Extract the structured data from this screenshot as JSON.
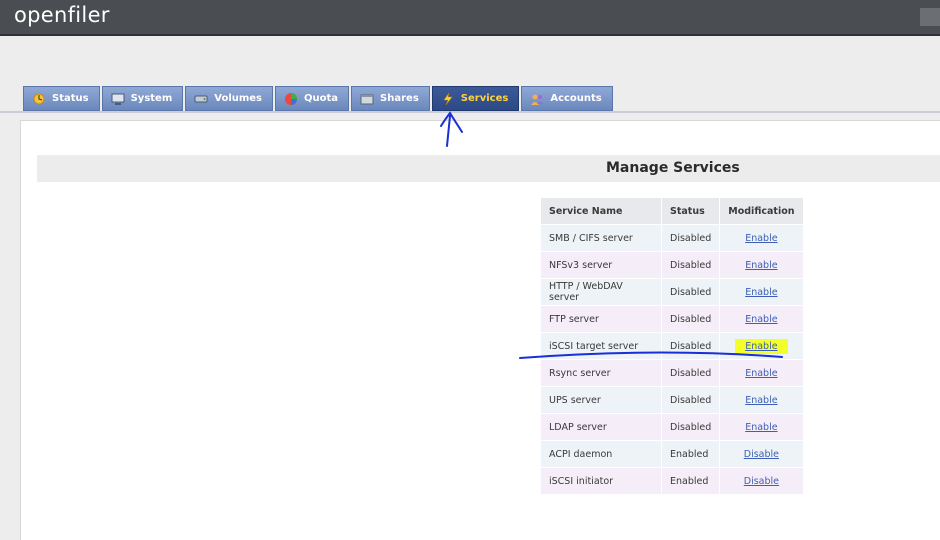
{
  "app": {
    "logo": "openfiler"
  },
  "tabs": [
    {
      "label": "Status",
      "icon": "status-icon",
      "active": false
    },
    {
      "label": "System",
      "icon": "system-icon",
      "active": false
    },
    {
      "label": "Volumes",
      "icon": "volumes-icon",
      "active": false
    },
    {
      "label": "Quota",
      "icon": "quota-icon",
      "active": false
    },
    {
      "label": "Shares",
      "icon": "shares-icon",
      "active": false
    },
    {
      "label": "Services",
      "icon": "services-icon",
      "active": true
    },
    {
      "label": "Accounts",
      "icon": "accounts-icon",
      "active": false
    }
  ],
  "page": {
    "title": "Manage Services"
  },
  "table": {
    "headers": [
      "Service Name",
      "Status",
      "Modification"
    ],
    "rows": [
      {
        "name": "SMB / CIFS server",
        "status": "Disabled",
        "action": "Enable"
      },
      {
        "name": "NFSv3 server",
        "status": "Disabled",
        "action": "Enable"
      },
      {
        "name": "HTTP / WebDAV server",
        "status": "Disabled",
        "action": "Enable"
      },
      {
        "name": "FTP server",
        "status": "Disabled",
        "action": "Enable"
      },
      {
        "name": "iSCSI target server",
        "status": "Disabled",
        "action": "Enable",
        "highlighted": true
      },
      {
        "name": "Rsync server",
        "status": "Disabled",
        "action": "Enable"
      },
      {
        "name": "UPS server",
        "status": "Disabled",
        "action": "Enable"
      },
      {
        "name": "LDAP server",
        "status": "Disabled",
        "action": "Enable"
      },
      {
        "name": "ACPI daemon",
        "status": "Enabled",
        "action": "Disable"
      },
      {
        "name": "iSCSI initiator",
        "status": "Enabled",
        "action": "Disable"
      }
    ]
  },
  "colors": {
    "topbar": "#4a4d52",
    "tab": "#7f9acb",
    "tab_active": "#2d4a86",
    "tab_active_text": "#ffd43b",
    "link": "#3d5fb4",
    "highlight": "#f3ff2a",
    "annotation_ink": "#1a2fd6"
  }
}
